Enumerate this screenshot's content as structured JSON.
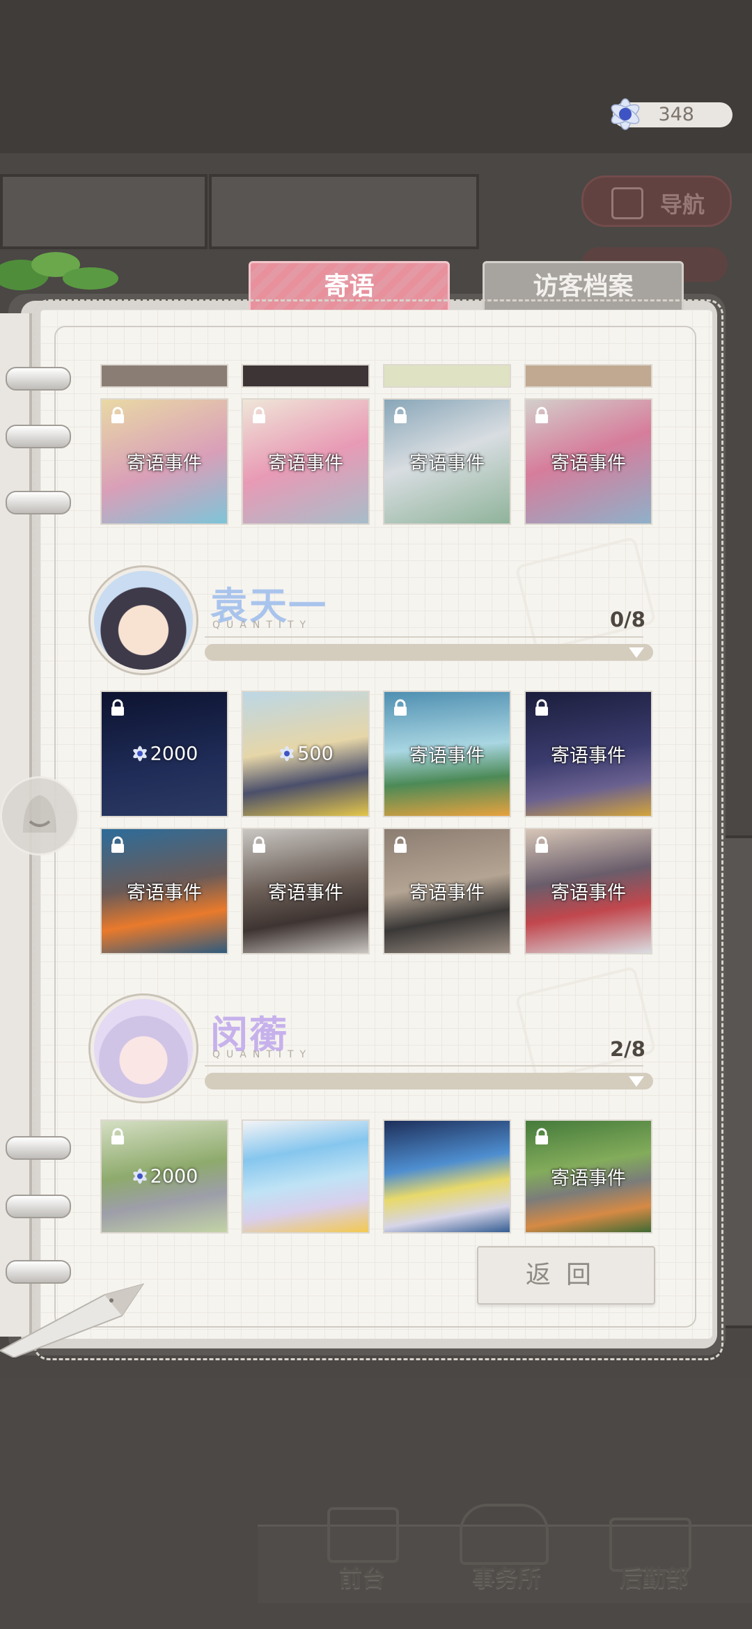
{
  "currency": {
    "amount": "348",
    "icon": "blue-flower-gem-icon"
  },
  "scene": {
    "nav_button": "导航"
  },
  "tabs": [
    {
      "label": "寄语",
      "active": true
    },
    {
      "label": "访客档案",
      "active": false
    }
  ],
  "top_row": [
    {
      "label": "寄语事件",
      "locked": true
    },
    {
      "label": "寄语事件",
      "locked": true
    },
    {
      "label": "寄语事件",
      "locked": true
    },
    {
      "label": "寄语事件",
      "locked": true
    }
  ],
  "characters": [
    {
      "name": "袁天一",
      "quantity_label": "QUANTITY",
      "count": "0/8",
      "progress": 0.0,
      "name_color": "#a9c4ec",
      "cards": [
        {
          "type": "cost",
          "cost": "2000",
          "locked": true
        },
        {
          "type": "cost",
          "cost": "500",
          "locked": false
        },
        {
          "type": "event",
          "label": "寄语事件",
          "locked": true
        },
        {
          "type": "event",
          "label": "寄语事件",
          "locked": true
        },
        {
          "type": "event",
          "label": "寄语事件",
          "locked": true
        },
        {
          "type": "event",
          "label": "寄语事件",
          "locked": true
        },
        {
          "type": "event",
          "label": "寄语事件",
          "locked": true
        },
        {
          "type": "event",
          "label": "寄语事件",
          "locked": true
        }
      ]
    },
    {
      "name": "闵蘅",
      "quantity_label": "QUANTITY",
      "count": "2/8",
      "progress": 0.25,
      "name_color": "#c6b1ec",
      "cards": [
        {
          "type": "cost",
          "cost": "2000",
          "locked": true
        },
        {
          "type": "unlocked",
          "label": ""
        },
        {
          "type": "unlocked",
          "label": ""
        },
        {
          "type": "event",
          "label": "寄语事件",
          "locked": true
        }
      ]
    }
  ],
  "return_button": "返回",
  "bottom_nav": [
    "前台",
    "事务所",
    "后勤部"
  ]
}
